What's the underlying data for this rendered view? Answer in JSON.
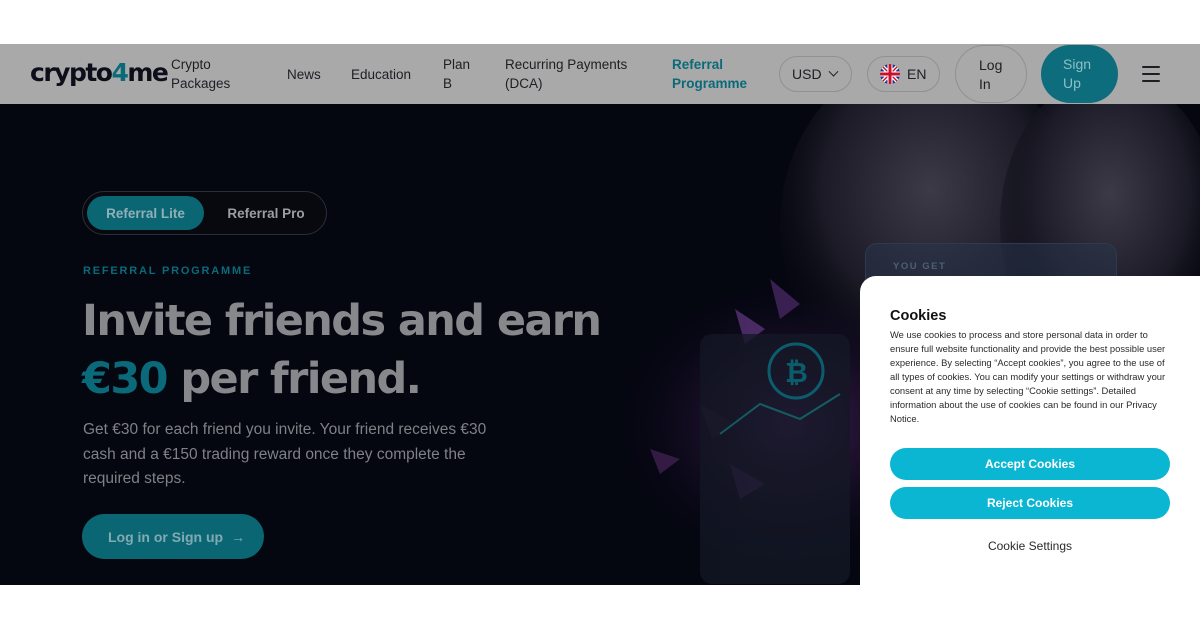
{
  "header": {
    "logo_prefix": "crypto",
    "logo_number": "4",
    "logo_suffix": "me",
    "nav": [
      {
        "label": "Crypto Packages"
      },
      {
        "label": "News"
      },
      {
        "label": "Education"
      },
      {
        "label": "Plan B"
      },
      {
        "label": "Recurring Payments (DCA)"
      },
      {
        "label": "Referral Programme",
        "active": true
      }
    ],
    "currency": "USD",
    "language": "EN",
    "login_label": "Log In",
    "signup_label": "Sign Up"
  },
  "hero": {
    "tabs": [
      {
        "label": "Referral Lite",
        "selected": true
      },
      {
        "label": "Referral Pro",
        "selected": false
      }
    ],
    "eyebrow": "REFERRAL PROGRAMME",
    "headline_part1": "Invite friends and earn",
    "headline_amount": "€30",
    "headline_part2": " per friend.",
    "description": "Get €30 for each friend you invite. Your friend receives €30 cash and a €150 trading reward once they complete the required steps.",
    "cta_label": "Log in or Sign up",
    "card_label": "YOU GET"
  },
  "cookie_banner": {
    "title": "Cookies",
    "body": "We use cookies to process and store personal data in order to ensure full website functionality and provide the best possible user experience. By selecting “Accept cookies”, you agree to the use of all types of cookies. You can modify your settings or withdraw your consent at any time by selecting “Cookie settings”. Detailed information about the use of cookies can be found in our Privacy Notice.",
    "accept_label": "Accept Cookies",
    "reject_label": "Reject Cookies",
    "settings_label": "Cookie Settings"
  },
  "colors": {
    "accent": "#0bb6d3",
    "brand_teal": "#0b6a7a",
    "hero_background": "#040610"
  },
  "icons": [
    "uk-flag-icon",
    "chevron-down-icon",
    "hamburger-menu-icon",
    "arrow-right-icon",
    "bitcoin-icon"
  ]
}
